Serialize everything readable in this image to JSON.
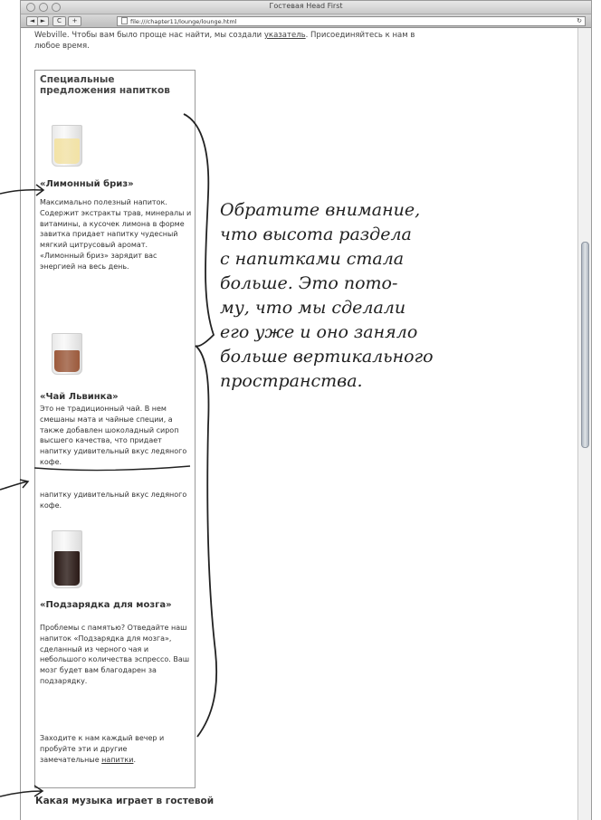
{
  "window": {
    "title": "Гостевая Head First",
    "url": "file:///chapter11/lounge/lounge.html"
  },
  "toolbar": {
    "back_label": "◄",
    "forward_label": "►",
    "reload_label": "C",
    "add_label": "+",
    "url_refresh_label": "↻"
  },
  "page": {
    "intro_line1_prefix": "Webville. Чтобы вам было проще нас найти, мы создали ",
    "intro_link": "указатель",
    "intro_line1_suffix": ". Присоединяйтесь к нам в",
    "intro_line2": "любое время.",
    "sidebar": {
      "title": "Специальные предложения напитков",
      "drinks": [
        {
          "name": "«Лимонный бриз»",
          "description": "Максимально полезный напиток. Содержит экстракты трав, минералы и витамины, а кусочек лимона в форме завитка придает напитку чудесный мягкий цитрусовый аромат. «Лимонный бриз» зарядит вас энергией на весь день.",
          "color": "#f3e3a6"
        },
        {
          "name": "«Чай Львинка»",
          "description": "Это не традиционный чай. В нем смешаны мата и чайные специи, а также добавлен шоколадный сироп высшего качества, что придает напитку удивительный вкус ледяного кофе.",
          "description_repeat": "напитку удивительный вкус ледяного кофе.",
          "color": "#9c5a3c"
        },
        {
          "name": "«Подзарядка для мозга»",
          "description": "Проблемы с памятью? Отведайте наш напиток «Подзарядка для мозга», сделанный из черного чая и небольшого количества эспрессо. Ваш мозг будет вам благодарен за подзарядку.",
          "color": "#2a1a16"
        }
      ],
      "footer_prefix": "Заходите к нам каждый вечер и пробуйте эти и другие замечательные ",
      "footer_link": "напитки",
      "footer_suffix": "."
    },
    "music_heading": "Какая музыка играет в гостевой"
  },
  "annotation": {
    "lines": [
      "Обратите внимание,",
      "что высота раздела",
      "с напитками стала",
      "больше. Это пото-",
      "му, что мы сделали",
      "его уже и оно заняло",
      "больше вертикального",
      "пространства."
    ]
  }
}
